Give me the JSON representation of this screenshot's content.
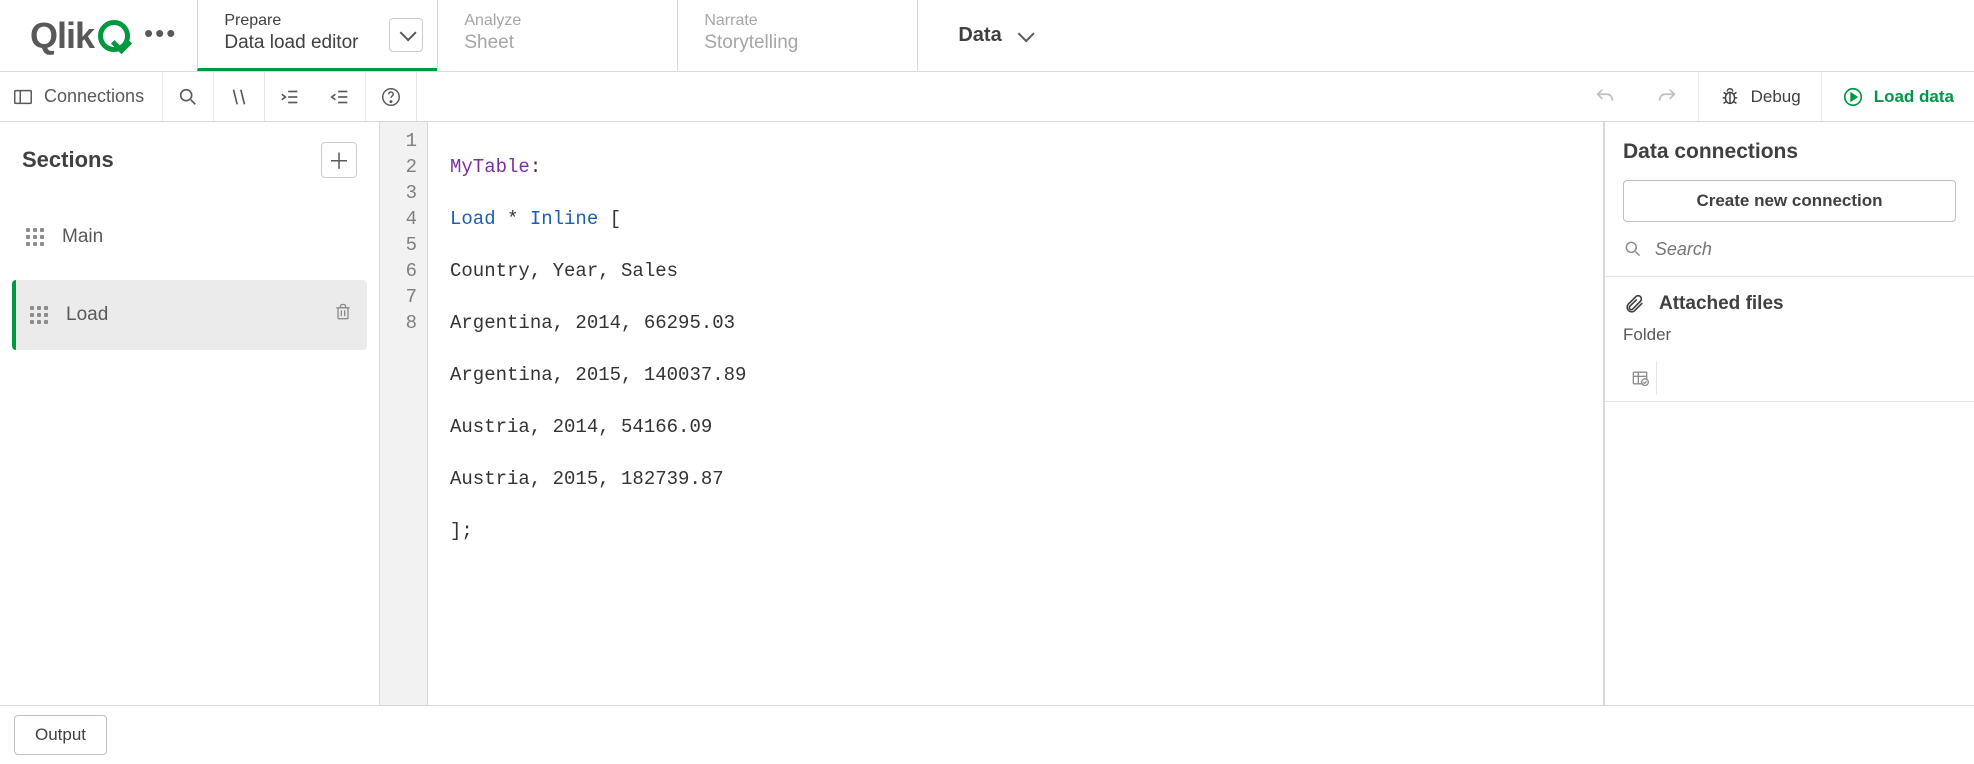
{
  "logo_text": "Qlik",
  "nav": {
    "prepare": {
      "small": "Prepare",
      "big": "Data load editor"
    },
    "analyze": {
      "small": "Analyze",
      "big": "Sheet"
    },
    "narrate": {
      "small": "Narrate",
      "big": "Storytelling"
    },
    "data_label": "Data"
  },
  "toolbar": {
    "connections": "Connections",
    "debug": "Debug",
    "load_data": "Load data"
  },
  "sections": {
    "title": "Sections",
    "items": [
      {
        "label": "Main",
        "active": false
      },
      {
        "label": "Load",
        "active": true
      }
    ]
  },
  "editor": {
    "line_numbers": [
      "1",
      "2",
      "3",
      "4",
      "5",
      "6",
      "7",
      "8"
    ],
    "lines": {
      "l1_name": "MyTable",
      "l1_colon": ":",
      "l2_load": "Load",
      "l2_star": " * ",
      "l2_inline": "Inline",
      "l2_brk": " [",
      "l3": "Country, Year, Sales",
      "l4": "Argentina, 2014, 66295.03",
      "l5": "Argentina, 2015, 140037.89",
      "l6": "Austria, 2014, 54166.09",
      "l7": "Austria, 2015, 182739.87",
      "l8": "];"
    }
  },
  "right": {
    "title": "Data connections",
    "create_btn": "Create new connection",
    "search_placeholder": "Search",
    "attached_title": "Attached files",
    "folder_label": "Folder"
  },
  "footer": {
    "output": "Output"
  }
}
